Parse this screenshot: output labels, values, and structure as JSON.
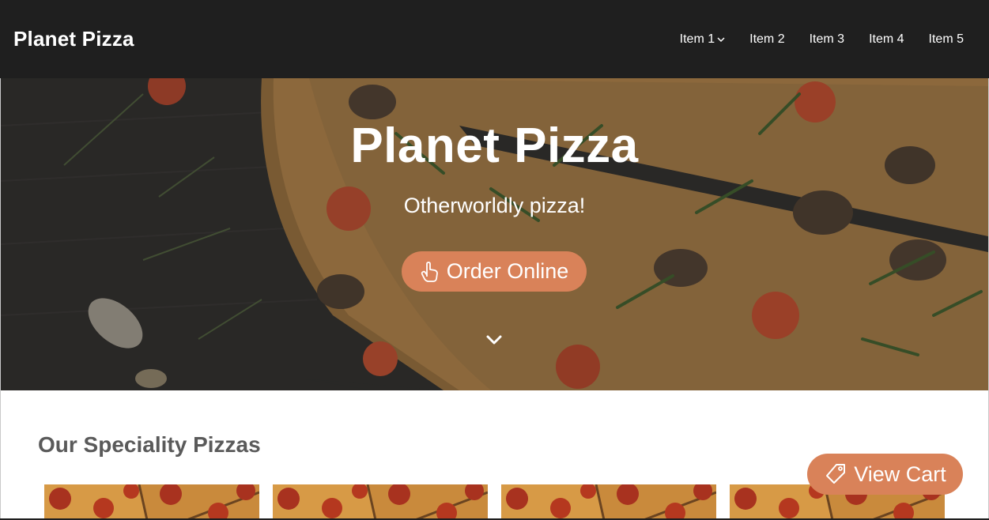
{
  "navbar": {
    "brand": "Planet Pizza",
    "items": [
      {
        "label": "Item 1",
        "has_dropdown": true
      },
      {
        "label": "Item 2"
      },
      {
        "label": "Item 3"
      },
      {
        "label": "Item 4"
      },
      {
        "label": "Item 5"
      }
    ],
    "background": "#1f1f1f"
  },
  "hero": {
    "title": "Planet Pizza",
    "subtitle": "Otherworldly pizza!",
    "cta_label": "Order Online",
    "cta_icon": "pointing-hand-icon",
    "scroll_icon": "chevron-down-icon"
  },
  "specialities": {
    "title": "Our Speciality Pizzas",
    "cards": [
      {
        "image": "pepperoni-pizza-image"
      },
      {
        "image": "pepperoni-pizza-image"
      },
      {
        "image": "pepperoni-pizza-image"
      },
      {
        "image": "pepperoni-pizza-image"
      }
    ]
  },
  "cart": {
    "label": "View Cart",
    "icon": "tag-icon"
  },
  "colors": {
    "accent": "#d98259",
    "heading": "#5a5a5a"
  }
}
